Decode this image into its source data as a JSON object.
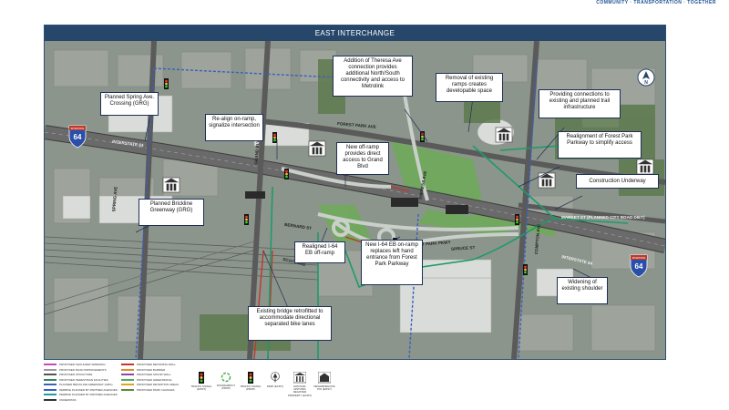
{
  "tagline": "COMMUNITY · TRANSPORTATION · TOGETHER",
  "map": {
    "title": "EAST INTERCHANGE",
    "north_label": "N",
    "shield_number": "64",
    "shield_top_text": "INTERSTATE",
    "road_labels": {
      "interstate_64_west": "INTERSTATE 64",
      "interstate_64_east": "INTERSTATE 64",
      "forest_park_ave": "FOREST PARK AVE",
      "spring_ave": "SPRING AVE",
      "grand_blvd": "GRAND BLVD",
      "theresa_ave": "THERESA AVE",
      "compton_ave": "COMPTON AVE",
      "market_st": "MARKET ST (PLANNED CITY ROAD DIET)",
      "bernard_st": "BERNARD ST",
      "scott_ave": "SCOTT AVE",
      "spruce_st": "SPRUCE ST",
      "forest_park_pkwy": "FOREST PARK PKWY"
    },
    "callouts": {
      "theresa": "Addition of Theresa Ave connection provides additional North/South connectivity and access to Metrolink",
      "spring": "Planned Spring Ave. Crossing (GRG)",
      "realign": "Re-align on-ramp, signalize intersection",
      "removal": "Removal of existing ramps creates developable space",
      "connections": "Providing connections to existing and planned trail infrastructure",
      "offramp_new": "New off-ramp provides direct access to Grand Blvd",
      "forest_park": "Realignment of Forest Park Parkway to simplify access",
      "construction": "Construction Underway",
      "brickline": "Planned Brickline Greenway (GRG)",
      "realigned_eb": "Realigned I-64 EB off-ramp",
      "new_eb": "New I-64 EB on-ramp replaces left hand entrance from Forest Park Parkway",
      "widening": "Widening of existing shoulder",
      "bridge": "Existing bridge retrofitted to accommodate directional separated bike lanes"
    }
  },
  "legend": {
    "lines": [
      {
        "label": "PROPOSED SHOULDER WIDENING",
        "color": "#c04cc0"
      },
      {
        "label": "PROPOSED ROAD IMPROVEMENTS",
        "color": "#9a9a9a"
      },
      {
        "label": "PROPOSED STRUCTURE",
        "color": "#555555"
      },
      {
        "label": "PROPOSED PEDESTRIAN FACILITIES",
        "color": "#2e8b57"
      },
      {
        "label": "PLANNED BRICKLINE GREENWAY (GRG)",
        "color": "#3b5fc0"
      },
      {
        "label": "PEDBIKE PLANNED BY PARTNER AGENCIES",
        "color": "#3b5fc0"
      },
      {
        "label": "PEDBIKE PLANNED BY PARTNER AGENCIES",
        "color": "#1aa0a0"
      },
      {
        "label": "UNDERPASS",
        "color": "#333333"
      },
      {
        "label": "PROPOSED RETAINING WALL",
        "color": "#c0392b"
      },
      {
        "label": "PROPOSED BARRIER",
        "color": "#e08a2a"
      },
      {
        "label": "PROPOSED SOUND WALL",
        "color": "#8e44ad"
      },
      {
        "label": "PROPOSED GREENSPACE",
        "color": "#4caf50"
      },
      {
        "label": "PROPOSED DETENTION AREAS",
        "color": "#e0a030"
      },
      {
        "label": "PROPOSED PARK CHANGES",
        "color": "#5f8a3a"
      }
    ],
    "icons": [
      {
        "label": "TRAFFIC SIGNAL (EXIST)"
      },
      {
        "label": "ROUNDABOUT (PROP)"
      },
      {
        "label": "TRAFFIC SIGNAL (PROP)"
      },
      {
        "label": "PARK (EXIST)"
      },
      {
        "label": "NATIONAL HISTORIC REGISTER PROPERTY (EXIST)"
      },
      {
        "label": "NEIGHBORHOOD POI (EXIST)"
      }
    ]
  },
  "colors": {
    "header": "#27476a",
    "highway": "#4a4a4a",
    "proposed_road": "#c9cfc9",
    "ped": "#2e8b57",
    "greenway": "#3b5fc0",
    "retaining": "#c0392b"
  }
}
